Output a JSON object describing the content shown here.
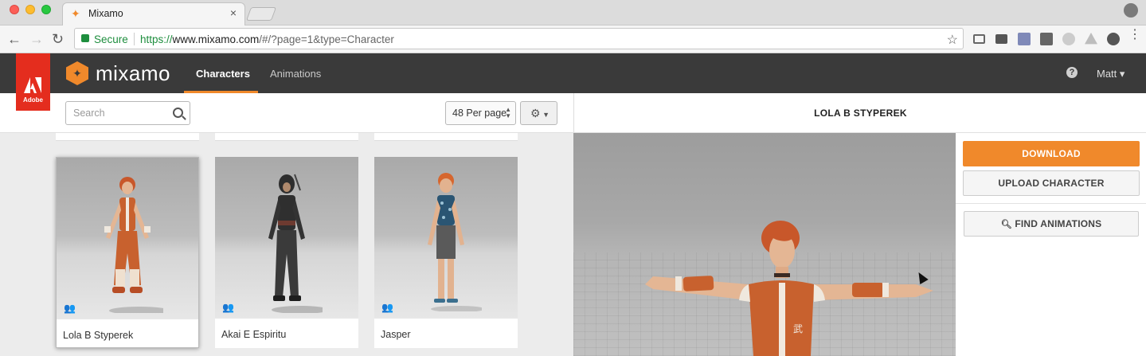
{
  "browser": {
    "tab_title": "Mixamo",
    "secure_label": "Secure",
    "url_scheme": "https://",
    "url_host": "www.mixamo.com",
    "url_path": "/#/?page=1&type=Character"
  },
  "header": {
    "adobe_label": "Adobe",
    "logo_text": "mixamo",
    "nav": [
      {
        "label": "Characters",
        "active": true
      },
      {
        "label": "Animations",
        "active": false
      }
    ],
    "user_label": "Matt",
    "accent_color": "#f0892b"
  },
  "filters": {
    "search_placeholder": "Search",
    "per_page": "48 Per page"
  },
  "characters": [
    {
      "name": "Lola B Styperek",
      "selected": true
    },
    {
      "name": "Akai E Espiritu",
      "selected": false
    },
    {
      "name": "Jasper",
      "selected": false
    }
  ],
  "detail": {
    "character_title": "LOLA B STYPEREK",
    "download_label": "DOWNLOAD",
    "upload_label": "UPLOAD CHARACTER",
    "find_label": "FIND ANIMATIONS"
  }
}
